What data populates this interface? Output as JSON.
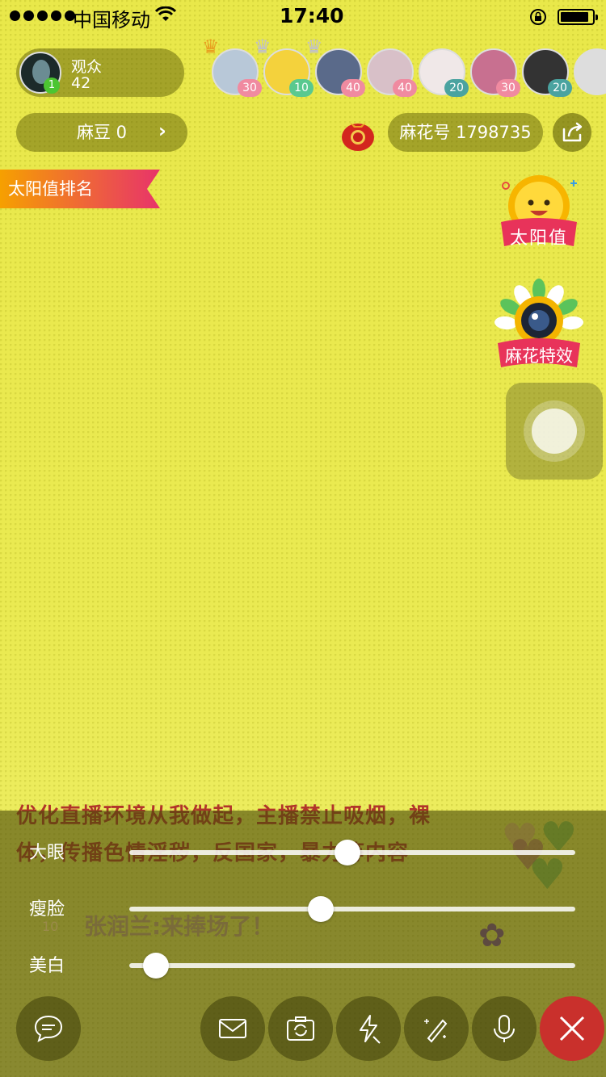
{
  "status_bar": {
    "carrier": "中国移动",
    "time": "17:40"
  },
  "host": {
    "label": "观众",
    "count": "42",
    "level": "1"
  },
  "viewers": [
    {
      "level": "30",
      "badge_color": "#f08aa0",
      "crown": true
    },
    {
      "level": "10",
      "badge_color": "#59c98f",
      "crown": true
    },
    {
      "level": "40",
      "badge_color": "#f08aa0",
      "crown": true
    },
    {
      "level": "40",
      "badge_color": "#f08aa0",
      "crown": false
    },
    {
      "level": "20",
      "badge_color": "#4aa3a0",
      "crown": false
    },
    {
      "level": "30",
      "badge_color": "#f08aa0",
      "crown": false
    },
    {
      "level": "20",
      "badge_color": "#4aa3a0",
      "crown": false
    }
  ],
  "madou": {
    "label": "麻豆 0",
    "arrow": "›"
  },
  "mahua_id": "麻花号 1798735",
  "rank_tag": "太阳值排名",
  "sun_badge": "太阳值",
  "effects_badge": "麻花特效",
  "notice": "优化直播环境从我做起，主播禁止吸烟，裸体，传播色情淫秽，反国家，暴力等内容",
  "chat": {
    "level": "10",
    "text": "张润兰:来捧场了！"
  },
  "beauty": [
    {
      "label": "大眼",
      "value": 0.46
    },
    {
      "label": "瘦脸",
      "value": 0.4
    },
    {
      "label": "美白",
      "value": 0.03
    }
  ],
  "colors": {
    "accent_red": "#c9302c",
    "rank_pink": "#e8336a",
    "rank_orange": "#f6a000"
  }
}
